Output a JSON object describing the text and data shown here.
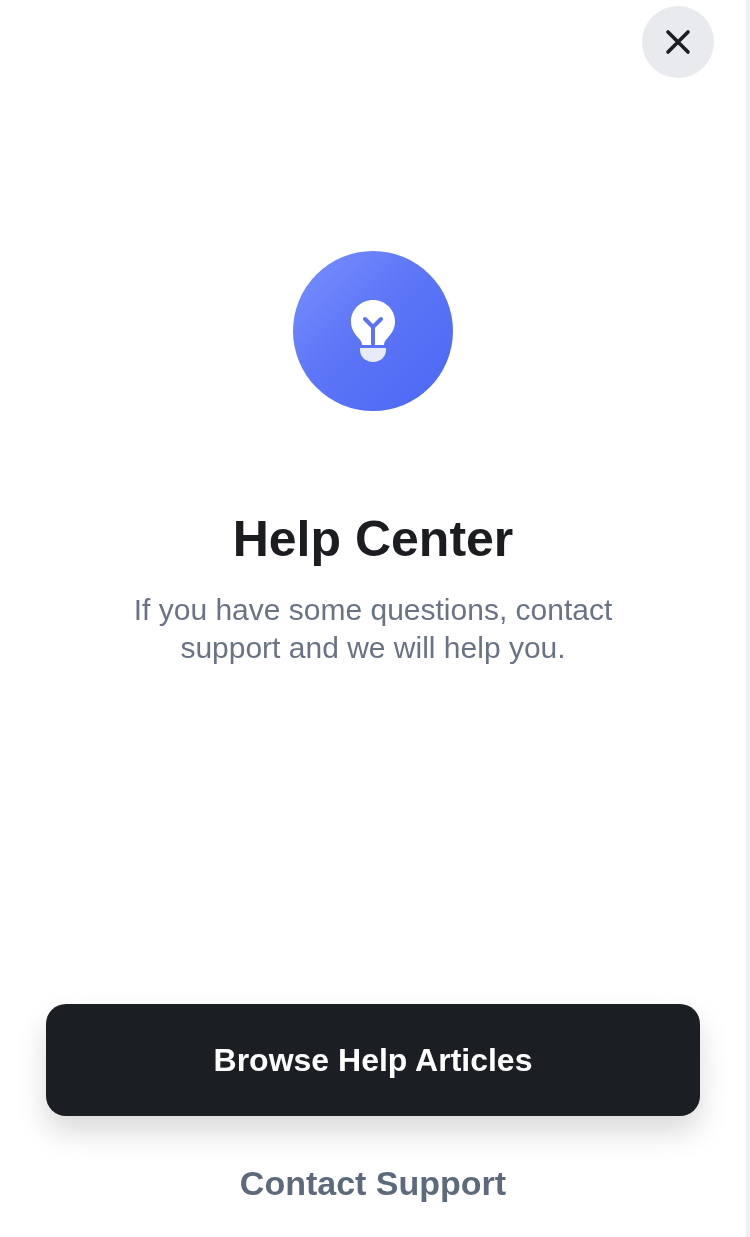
{
  "title": "Help Center",
  "description": "If you have some questions, contact support and we will help you.",
  "primary_button": {
    "label": "Browse Help Articles"
  },
  "secondary_link": {
    "label": "Contact Support"
  }
}
